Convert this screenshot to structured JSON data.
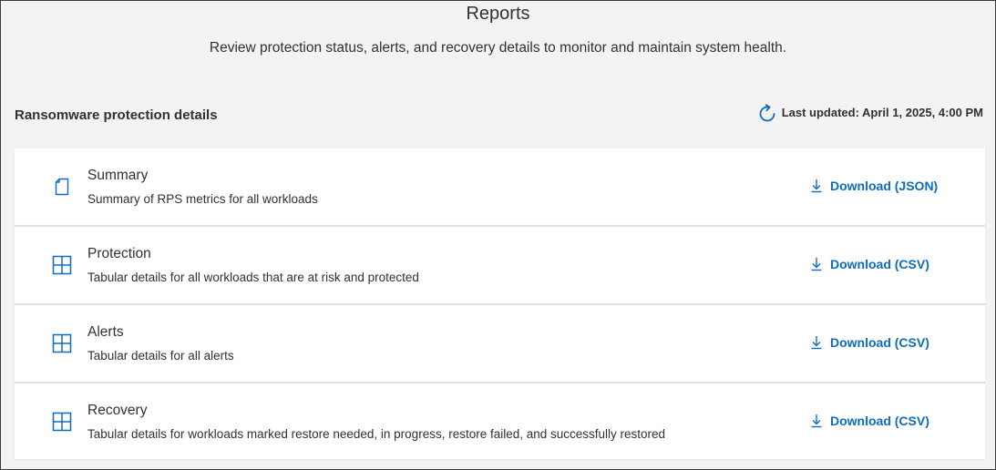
{
  "header": {
    "title": "Reports",
    "subtitle": "Review protection status, alerts, and recovery details to monitor and maintain system health."
  },
  "section": {
    "title": "Ransomware protection details",
    "refresh_icon": "refresh-icon",
    "last_updated": "Last updated: April 1, 2025, 4:00 PM"
  },
  "reports": [
    {
      "icon": "document-icon",
      "title": "Summary",
      "description": "Summary of RPS metrics for all workloads",
      "download_label": "Download (JSON)"
    },
    {
      "icon": "table-grid-icon",
      "title": "Protection",
      "description": "Tabular details for all workloads that are at risk and protected",
      "download_label": "Download (CSV)"
    },
    {
      "icon": "table-grid-icon",
      "title": "Alerts",
      "description": "Tabular details for all alerts",
      "download_label": "Download (CSV)"
    },
    {
      "icon": "table-grid-icon",
      "title": "Recovery",
      "description": "Tabular details for workloads marked restore needed, in progress, restore failed, and successfully restored",
      "download_label": "Download (CSV)"
    }
  ],
  "colors": {
    "accent": "#0f6cbd",
    "background": "#f3f3f3",
    "card": "#ffffff"
  }
}
